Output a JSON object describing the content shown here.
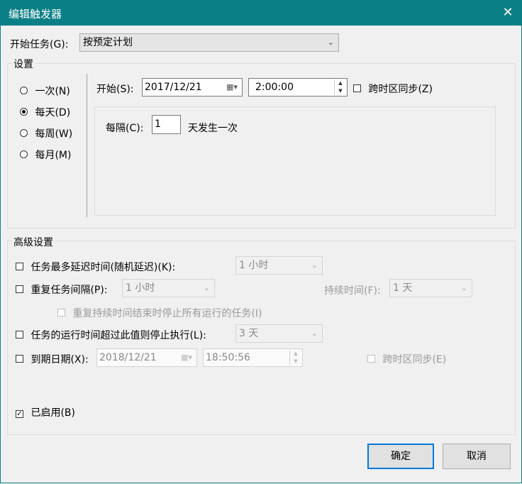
{
  "window": {
    "title": "编辑触发器",
    "close_glyph": "✕"
  },
  "begin_task": {
    "label": "开始任务(G):",
    "value": "按预定计划"
  },
  "settings": {
    "title": "设置",
    "schedule_options": [
      {
        "label": "一次(N)",
        "selected": false
      },
      {
        "label": "每天(D)",
        "selected": true
      },
      {
        "label": "每周(W)",
        "selected": false
      },
      {
        "label": "每月(M)",
        "selected": false
      }
    ],
    "start_label": "开始(S):",
    "start_date": "2017/12/21",
    "start_time": "2:00:00",
    "sync_tz_label": "跨时区同步(Z)",
    "recur_label": "每隔(C):",
    "recur_value": "1",
    "recur_suffix": "天发生一次"
  },
  "advanced": {
    "title": "高级设置",
    "delay_label": "任务最多延迟时间(随机延迟)(K):",
    "delay_value": "1 小时",
    "repeat_label": "重复任务间隔(P):",
    "repeat_value": "1 小时",
    "duration_label": "持续时间(F):",
    "duration_value": "1 天",
    "stop_all_label": "重复持续时间结束时停止所有运行的任务(I)",
    "stop_if_label": "任务的运行时间超过此值则停止执行(L):",
    "stop_if_value": "3 天",
    "expire_label": "到期日期(X):",
    "expire_date": "2018/12/21",
    "expire_time": "18:50:56",
    "expire_sync_label": "跨时区同步(E)",
    "enabled_label": "已启用(B)",
    "enabled_checked": true
  },
  "buttons": {
    "ok": "确定",
    "cancel": "取消"
  },
  "colors": {
    "titlebar": "#0a7f86",
    "accent": "#0078d7"
  }
}
